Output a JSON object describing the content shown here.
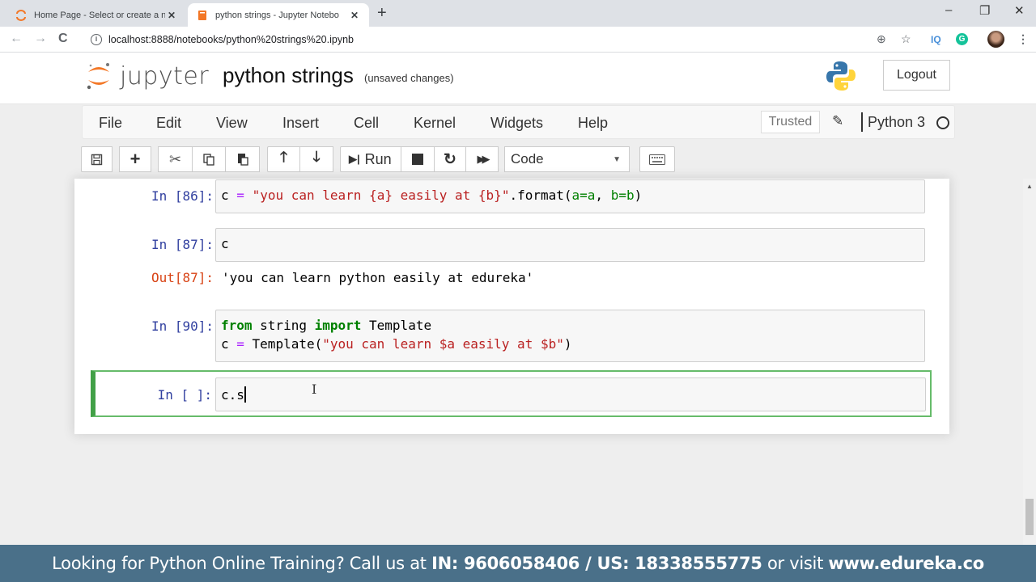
{
  "browser": {
    "tabs": [
      {
        "title": "Home Page - Select or create a n",
        "favicon": "jupyter-icon",
        "active": false
      },
      {
        "title": "python strings - Jupyter Notebo",
        "favicon": "notebook-icon",
        "active": true
      }
    ],
    "new_tab_label": "+",
    "window_controls": {
      "minimize": "–",
      "restore": "❐",
      "close": "✕"
    },
    "url": "localhost:8888/notebooks/python%20strings%20.ipynb",
    "extensions": [
      "zoom-icon",
      "star-icon",
      "iq-icon",
      "grammarly-icon",
      "profile-avatar",
      "menu-icon"
    ]
  },
  "header": {
    "logo_text": "jupyter",
    "notebook_title": "python strings",
    "save_status": "(unsaved changes)",
    "logout_label": "Logout"
  },
  "menubar": {
    "items": [
      "File",
      "Edit",
      "View",
      "Insert",
      "Cell",
      "Kernel",
      "Widgets",
      "Help"
    ],
    "trusted_label": "Trusted",
    "kernel_name": "Python 3"
  },
  "toolbar": {
    "run_label": "Run",
    "cell_type": "Code"
  },
  "cells": [
    {
      "prompt": "In [86]:",
      "type": "code"
    },
    {
      "prompt": "In [87]:",
      "type": "code",
      "source": "c",
      "output_prompt": "Out[87]:",
      "output": "'you can learn python easily at edureka'"
    },
    {
      "prompt": "In [90]:",
      "type": "code"
    },
    {
      "prompt": "In [ ]:",
      "type": "code",
      "source": "c.s",
      "selected": true
    }
  ],
  "code_tokens": {
    "c86": {
      "var": "c",
      "eq": "=",
      "str": "\"you can learn {a} easily at {b}\"",
      "rest1": ".format(",
      "arg": "a=a",
      "sep": ", ",
      "arg2": "b=b",
      "close": ")"
    },
    "c90": {
      "kw1": "from",
      "mod": " string ",
      "kw2": "import",
      "name": " Template",
      "line2_var": "c ",
      "line2_eq": "=",
      "line2_call": " Template(",
      "line2_str": "\"you can learn $a easily at $b\"",
      "line2_close": ")"
    }
  },
  "banner": {
    "text1": "Looking for Python Online Training? Call us at ",
    "in_label": "IN: 9606058406 / US: 18338555775",
    "text2": " or visit ",
    "site": "www.edureka.co"
  },
  "colors": {
    "prompt_in": "#303f9f",
    "prompt_out": "#d84315",
    "selected_cell_border": "#42a047",
    "banner_bg": "#4a7089"
  }
}
